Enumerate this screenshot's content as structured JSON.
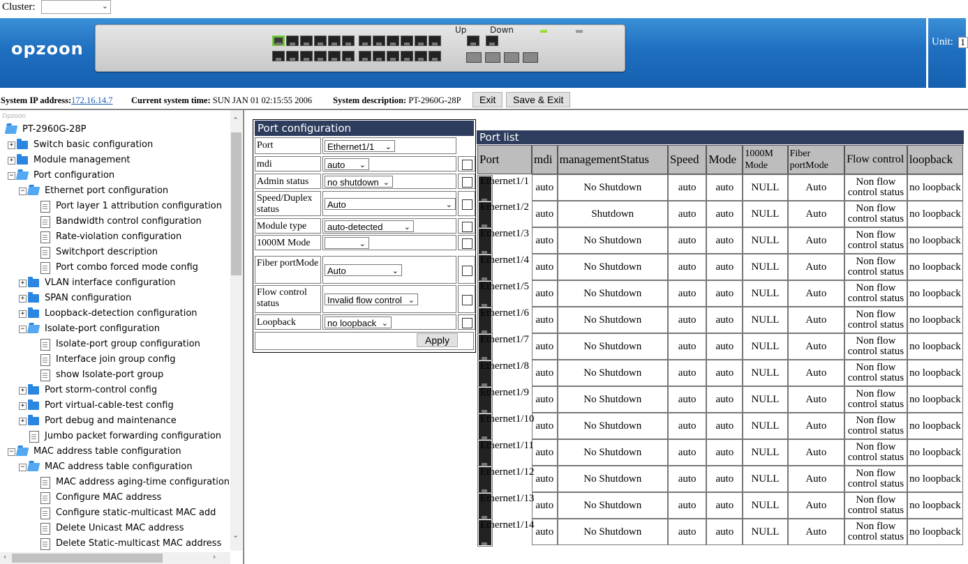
{
  "cluster": {
    "label": "Cluster:",
    "value": ""
  },
  "banner": {
    "logo": "opzoon",
    "legend_up": "Up",
    "legend_down": "Down",
    "unit_label": "Unit:",
    "unit_value": "1"
  },
  "info": {
    "ip_label": "System IP address:",
    "ip_value": "172.16.14.7",
    "time_label": "Current system time:",
    "time_value": "SUN JAN 01 02:15:55 2006",
    "desc_label": "System description:",
    "desc_value": "PT-2960G-28P",
    "exit_button": "Exit",
    "save_exit_button": "Save & Exit"
  },
  "tree": {
    "caption": "Opzoon",
    "items": [
      {
        "label": "PT-2960G-28P"
      },
      {
        "label": "Switch basic configuration"
      },
      {
        "label": "Module management"
      },
      {
        "label": "Port configuration"
      },
      {
        "label": "Ethernet port configuration"
      },
      {
        "label": "Port layer 1 attribution configuration"
      },
      {
        "label": "Bandwidth control configuration"
      },
      {
        "label": "Rate-violation configuration"
      },
      {
        "label": "Switchport description"
      },
      {
        "label": "Port combo forced mode config"
      },
      {
        "label": "VLAN interface configuration"
      },
      {
        "label": "SPAN configuration"
      },
      {
        "label": "Loopback-detection configuration"
      },
      {
        "label": "Isolate-port configuration"
      },
      {
        "label": "Isolate-port group configuration"
      },
      {
        "label": "Interface join group config"
      },
      {
        "label": "show Isolate-port group"
      },
      {
        "label": "Port storm-control config"
      },
      {
        "label": "Port virtual-cable-test config"
      },
      {
        "label": "Port debug and maintenance"
      },
      {
        "label": "Jumbo packet forwarding configuration"
      },
      {
        "label": "MAC address table configuration"
      },
      {
        "label": "MAC address table configuration"
      },
      {
        "label": "MAC address aging-time configuration"
      },
      {
        "label": "Configure MAC address"
      },
      {
        "label": "Configure static-multicast MAC add"
      },
      {
        "label": "Delete Unicast MAC address"
      },
      {
        "label": "Delete Static-multicast MAC address"
      }
    ]
  },
  "config": {
    "title": "Port configuration",
    "rows": [
      {
        "label": "Port",
        "value": "Ethernet1/1"
      },
      {
        "label": "mdi",
        "value": "auto"
      },
      {
        "label": "Admin status",
        "value": "no shutdown"
      },
      {
        "label": "Speed/Duplex status",
        "value": "Auto"
      },
      {
        "label": "Module type",
        "value": "auto-detected"
      },
      {
        "label": "1000M Mode",
        "value": ""
      },
      {
        "label": "Fiber portMode",
        "value": "Auto"
      },
      {
        "label": "Flow control status",
        "value": "Invalid flow control"
      },
      {
        "label": "Loopback",
        "value": "no loopback"
      }
    ],
    "apply_button": "Apply"
  },
  "portlist": {
    "title": "Port list",
    "headers": [
      "Port",
      "mdi",
      "managementStatus",
      "Speed",
      "Mode",
      "1000M Mode",
      "Fiber portMode",
      "Flow control",
      "loopback"
    ],
    "rows": [
      [
        "Ethernet1/1",
        "auto",
        "No Shutdown",
        "auto",
        "auto",
        "NULL",
        "Auto",
        "Non flow control status",
        "no loopback"
      ],
      [
        "Ethernet1/2",
        "auto",
        "Shutdown",
        "auto",
        "auto",
        "NULL",
        "Auto",
        "Non flow control status",
        "no loopback"
      ],
      [
        "Ethernet1/3",
        "auto",
        "No Shutdown",
        "auto",
        "auto",
        "NULL",
        "Auto",
        "Non flow control status",
        "no loopback"
      ],
      [
        "Ethernet1/4",
        "auto",
        "No Shutdown",
        "auto",
        "auto",
        "NULL",
        "Auto",
        "Non flow control status",
        "no loopback"
      ],
      [
        "Ethernet1/5",
        "auto",
        "No Shutdown",
        "auto",
        "auto",
        "NULL",
        "Auto",
        "Non flow control status",
        "no loopback"
      ],
      [
        "Ethernet1/6",
        "auto",
        "No Shutdown",
        "auto",
        "auto",
        "NULL",
        "Auto",
        "Non flow control status",
        "no loopback"
      ],
      [
        "Ethernet1/7",
        "auto",
        "No Shutdown",
        "auto",
        "auto",
        "NULL",
        "Auto",
        "Non flow control status",
        "no loopback"
      ],
      [
        "Ethernet1/8",
        "auto",
        "No Shutdown",
        "auto",
        "auto",
        "NULL",
        "Auto",
        "Non flow control status",
        "no loopback"
      ],
      [
        "Ethernet1/9",
        "auto",
        "No Shutdown",
        "auto",
        "auto",
        "NULL",
        "Auto",
        "Non flow control status",
        "no loopback"
      ],
      [
        "Ethernet1/10",
        "auto",
        "No Shutdown",
        "auto",
        "auto",
        "NULL",
        "Auto",
        "Non flow control status",
        "no loopback"
      ],
      [
        "Ethernet1/11",
        "auto",
        "No Shutdown",
        "auto",
        "auto",
        "NULL",
        "Auto",
        "Non flow control status",
        "no loopback"
      ],
      [
        "Ethernet1/12",
        "auto",
        "No Shutdown",
        "auto",
        "auto",
        "NULL",
        "Auto",
        "Non flow control status",
        "no loopback"
      ],
      [
        "Ethernet1/13",
        "auto",
        "No Shutdown",
        "auto",
        "auto",
        "NULL",
        "Auto",
        "Non flow control status",
        "no loopback"
      ],
      [
        "Ethernet1/14",
        "auto",
        "No Shutdown",
        "auto",
        "auto",
        "NULL",
        "Auto",
        "Non flow control status",
        "no loopback"
      ]
    ]
  }
}
